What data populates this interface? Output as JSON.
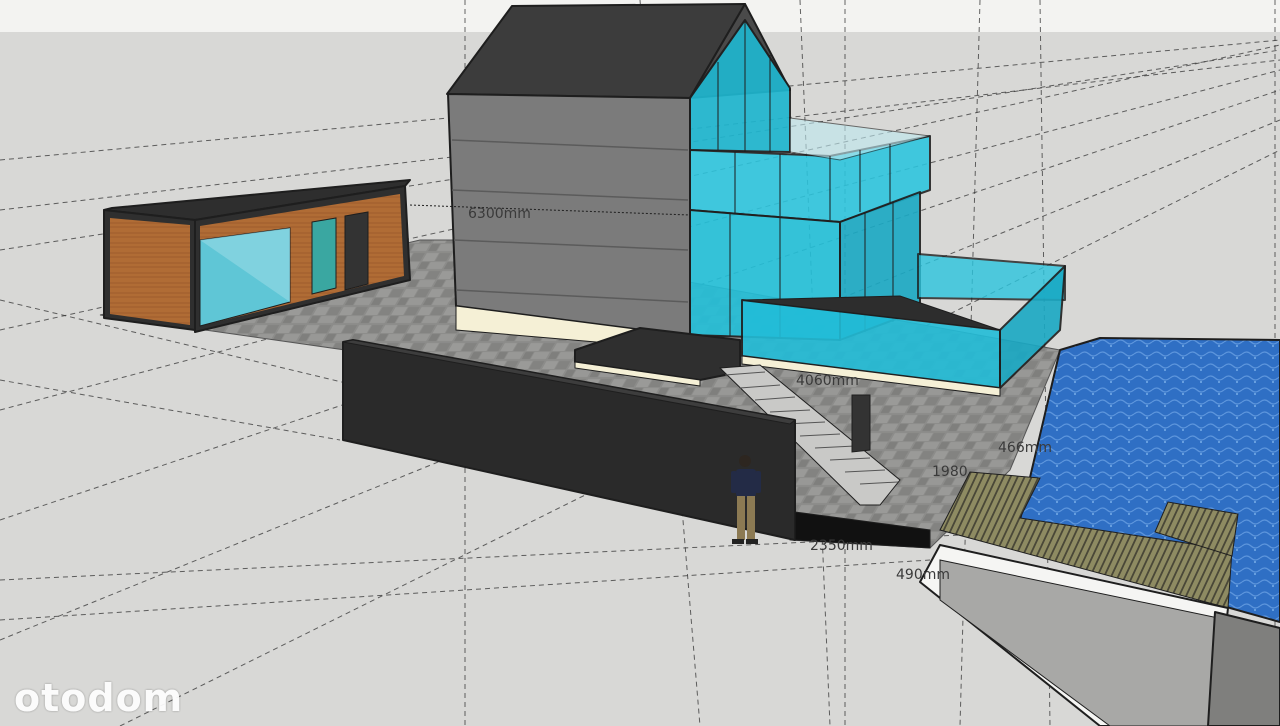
{
  "watermark": {
    "text": "otodom"
  },
  "dimensions": {
    "facade_height": "6300mm",
    "deck_width": "4060mm",
    "wall_offset": "2350mm",
    "step_edge": "490mm",
    "pool_edge": "1980",
    "pool_depth": "466mm"
  },
  "colors": {
    "sky": "#f3f3f1",
    "ground": "#d8d8d6",
    "glass": "#27c7df",
    "roof": "#3c3c3c",
    "facade": "#7b7b7b",
    "wood": "#b06c35",
    "pool": "#2f6fc4"
  }
}
